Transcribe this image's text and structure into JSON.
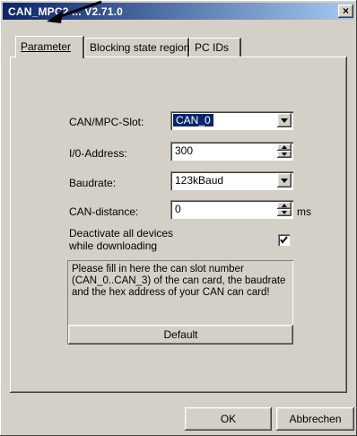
{
  "window": {
    "title": "CAN_MPC2 ... V2.71.0",
    "close_glyph": "×"
  },
  "tabs": [
    {
      "label": "Parameter",
      "active": true
    },
    {
      "label": "Blocking state region",
      "active": false
    },
    {
      "label": "PC IDs",
      "active": false
    }
  ],
  "form": {
    "slot_label": "CAN/MPC-Slot:",
    "slot_value": "CAN_0",
    "io_label": "I/0-Address:",
    "io_value": "300",
    "baud_label": "Baudrate:",
    "baud_value": "123kBaud",
    "candist_label": "CAN-distance:",
    "candist_value": "0",
    "candist_unit": "ms",
    "deactivate_label_line1": "Deactivate all devices",
    "deactivate_label_line2": "while downloading",
    "deactivate_checked": true
  },
  "info": {
    "text": "Please fill in here the can slot number (CAN_0..CAN_3) of the can card, the baudrate and the hex address of your CAN can card!"
  },
  "buttons": {
    "default": "Default",
    "ok": "OK",
    "cancel": "Abbrechen"
  },
  "icons": {
    "dropdown": "dropdown-arrow-icon",
    "spin_up": "spin-up-icon",
    "spin_down": "spin-down-icon",
    "check": "checkmark-icon",
    "pointer": "arrow-pointer-icon"
  }
}
